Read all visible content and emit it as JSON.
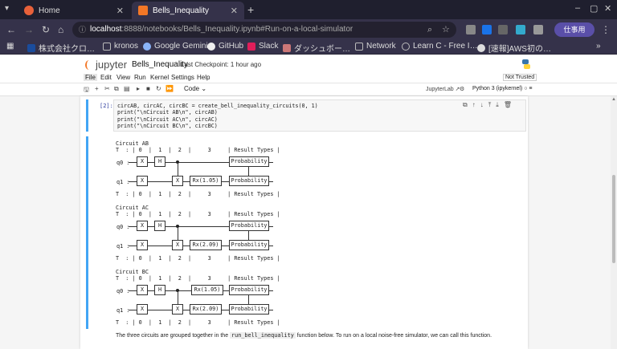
{
  "browser": {
    "tabs": [
      {
        "title": "Home",
        "active": false
      },
      {
        "title": "Bells_Inequality",
        "active": true
      }
    ],
    "url_host": "localhost",
    "url_rest": ":8888/notebooks/Bells_Inequality.ipynb#Run-on-a-local-simulator",
    "profile_label": "仕事用",
    "bookmarks": [
      "株式会社クロ…",
      "kronos",
      "Google Gemini",
      "GitHub",
      "Slack",
      "ダッシュボー…",
      "Network",
      "Learn C - Free I…",
      "[速報]AWS初の…"
    ]
  },
  "jupyter": {
    "logo": "jupyter",
    "notebook_name": "Bells_Inequality",
    "checkpoint": "Last Checkpoint: 1 hour ago",
    "menu": [
      "File",
      "Edit",
      "View",
      "Run",
      "Kernel",
      "Settings",
      "Help"
    ],
    "trust": "Not Trusted",
    "cell_type": "Code",
    "jupyterlab_link": "JupyterLab",
    "kernel": "Python 3 (ipykernel)"
  },
  "cell": {
    "prompt": "[2]:",
    "code": [
      "circAB, circAC, circBC = create_bell_inequality_circuits(0, 1)",
      "print(\"\\nCircuit AB\\n\", circAB)",
      "print(\"\\nCircuit AC\\n\", circAC)",
      "print(\"\\nCircuit BC\\n\", circBC)"
    ]
  },
  "circuits": [
    {
      "title": "Circuit AB",
      "header": "T  : | 0  |  1  |  2  |     3     | Result Types |",
      "footer": "T  : | 0  |  1  |  2  |     3     | Result Types |",
      "q0_gates": [
        "X",
        "H"
      ],
      "q1_gates": [
        "X",
        "X",
        "Rx(1.05)"
      ],
      "result": "Probability"
    },
    {
      "title": "Circuit AC",
      "header": "T  : | 0  |  1  |  2  |     3     | Result Types |",
      "footer": "T  : | 0  |  1  |  2  |     3     | Result Types |",
      "q0_gates": [
        "X",
        "H"
      ],
      "q1_gates": [
        "X",
        "X",
        "Rx(2.09)"
      ],
      "result": "Probability"
    },
    {
      "title": "Circuit BC",
      "header": "T  : | 0  |  1  |  2  |     3     | Result Types |",
      "footer": "T  : | 0  |  1  |  2  |     3     | Result Types |",
      "q0_gates": [
        "X",
        "H",
        "Rx(1.05)"
      ],
      "q1_gates": [
        "X",
        "X",
        "Rx(2.09)"
      ],
      "result": "Probability"
    }
  ],
  "qubit_labels": [
    "q0 :",
    "q1 :"
  ],
  "markdown": {
    "before": "The three circuits are grouped together in the ",
    "code": "run_bell_inequality",
    "after": " function below. To run on a local noise-free simulator, we can call this function."
  }
}
